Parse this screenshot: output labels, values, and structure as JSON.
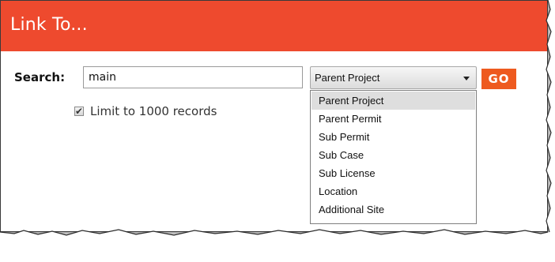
{
  "dialog": {
    "title": "Link To..."
  },
  "search": {
    "label": "Search:",
    "value": "main"
  },
  "link_type": {
    "selected": "Parent Project",
    "options": [
      "Parent Project",
      "Parent Permit",
      "Sub Permit",
      "Sub Case",
      "Sub License",
      "Location",
      "Additional Site"
    ]
  },
  "go_button": {
    "label": "GO"
  },
  "limit_checkbox": {
    "label": "Limit to 1000 records",
    "checked": true
  },
  "colors": {
    "header": "#ee4a2e",
    "go_button": "#ee5a1f"
  },
  "icons": {
    "checkbox": "checkmark-icon",
    "select": "chevron-down-icon"
  }
}
